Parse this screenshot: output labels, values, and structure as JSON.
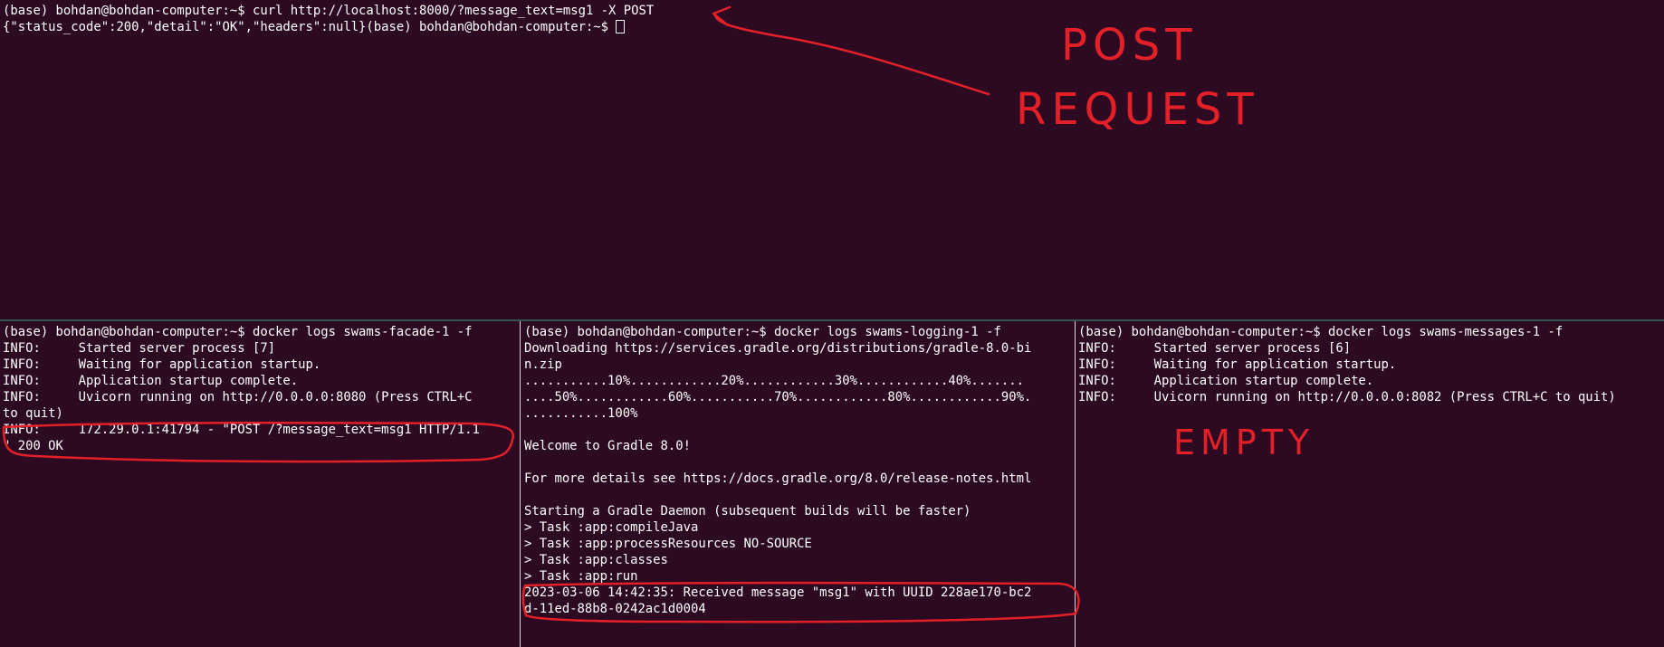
{
  "top_pane": {
    "lines": [
      "(base) bohdan@bohdan-computer:~$ curl http://localhost:8000/?message_text=msg1 -X POST",
      "{\"status_code\":200,\"detail\":\"OK\",\"headers\":null}(base) bohdan@bohdan-computer:~$ "
    ]
  },
  "facade_pane": {
    "lines": [
      "(base) bohdan@bohdan-computer:~$ docker logs swams-facade-1 -f",
      "INFO:     Started server process [7]",
      "INFO:     Waiting for application startup.",
      "INFO:     Application startup complete.",
      "INFO:     Uvicorn running on http://0.0.0.0:8080 (Press CTRL+C",
      "to quit)",
      "INFO:     172.29.0.1:41794 - \"POST /?message_text=msg1 HTTP/1.1",
      "\" 200 OK"
    ]
  },
  "logging_pane": {
    "lines": [
      "(base) bohdan@bohdan-computer:~$ docker logs swams-logging-1 -f",
      "Downloading https://services.gradle.org/distributions/gradle-8.0-bi",
      "n.zip",
      "...........10%............20%............30%............40%.......",
      "....50%............60%...........70%............80%............90%.",
      "...........100%",
      "",
      "Welcome to Gradle 8.0!",
      "",
      "For more details see https://docs.gradle.org/8.0/release-notes.html",
      "",
      "Starting a Gradle Daemon (subsequent builds will be faster)",
      "> Task :app:compileJava",
      "> Task :app:processResources NO-SOURCE",
      "> Task :app:classes",
      "> Task :app:run",
      "2023-03-06 14:42:35: Received message \"msg1\" with UUID 228ae170-bc2",
      "d-11ed-88b8-0242ac1d0004"
    ]
  },
  "messages_pane": {
    "lines": [
      "(base) bohdan@bohdan-computer:~$ docker logs swams-messages-1 -f",
      "INFO:     Started server process [6]",
      "INFO:     Waiting for application startup.",
      "INFO:     Application startup complete.",
      "INFO:     Uvicorn running on http://0.0.0.0:8082 (Press CTRL+C to quit)"
    ]
  },
  "annotations": {
    "post_line1": "POST",
    "post_line2": "REQUEST",
    "empty": "EMPTY"
  },
  "colors": {
    "background": "#2c0a22",
    "text": "#ffffff",
    "annotation": "#e32027"
  }
}
